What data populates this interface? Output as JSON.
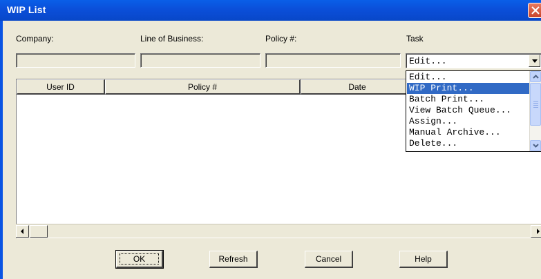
{
  "window": {
    "title": "WIP List"
  },
  "filters": {
    "company_label": "Company:",
    "lob_label": "Line of Business:",
    "policy_label": "Policy #:",
    "task_label": "Task",
    "company_value": "",
    "lob_value": "",
    "policy_value": "",
    "task_value": "Edit..."
  },
  "list": {
    "columns": [
      "User ID",
      "Policy #",
      "Date"
    ]
  },
  "task_dropdown": {
    "options": [
      "Edit...",
      "WIP Print...",
      "Batch Print...",
      "View Batch Queue...",
      "Assign...",
      "Manual Archive...",
      "Delete..."
    ],
    "selected_index": 1
  },
  "buttons": {
    "ok": "OK",
    "refresh": "Refresh",
    "cancel": "Cancel",
    "help": "Help"
  },
  "colors": {
    "titlebar": "#0b4fd9",
    "selection": "#316ac5",
    "dialog_bg": "#ece9d8"
  }
}
